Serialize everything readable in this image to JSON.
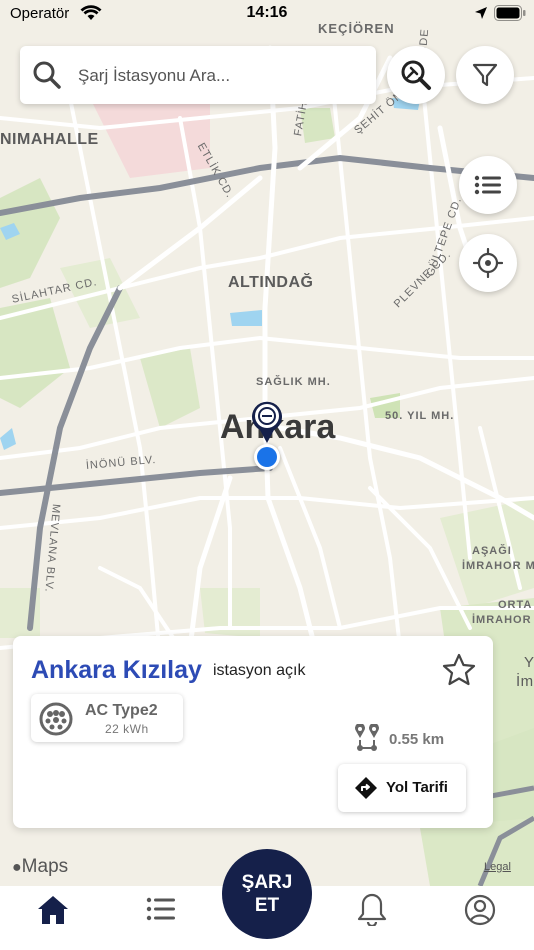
{
  "status_bar": {
    "carrier": "Operatör",
    "time": "14:16"
  },
  "search": {
    "placeholder": "Şarj İstasyonu Ara..."
  },
  "map": {
    "labels": {
      "kecioren": "KEÇİÖREN",
      "nimahalle": "NIMAHALLE",
      "etlik": "ETLİK CD.",
      "fatih": "FATİH",
      "sehit": "ŞEHİT ÖMER",
      "sde": "SDE",
      "altindag": "ALTINDAĞ",
      "silahtar": "SİLAHTAR CD.",
      "plevne": "PLEVNE CD.",
      "gultepe": "GÜLTEPE CD.",
      "saglik": "SAĞLIK MH.",
      "city": "Ankara",
      "elli_yil": "50. YIL MH.",
      "inonu": "İNÖNÜ BLV.",
      "mevlana": "MEVLANA BLV.",
      "asagi": "AŞAĞI",
      "imrahor": "İMRAHOR MH.",
      "orta": "ORTA",
      "imrahor2": "İMRAHOR",
      "edge_y": "Y",
      "edge_im": "İm"
    },
    "attribution": "Maps",
    "legal": "Legal"
  },
  "station_card": {
    "name": "Ankara Kızılay",
    "status": "istasyon açık",
    "connector_type": "AC Type2",
    "connector_power": "22 kWh",
    "distance": "0.55 km",
    "route_label": "Yol Tarifi"
  },
  "tab_bar": {
    "charge_line1": "ŞARJ",
    "charge_line2": "ET"
  },
  "colors": {
    "accent": "#2d4bb5",
    "charge_button": "#15204a",
    "user_location": "#1a73e8"
  }
}
